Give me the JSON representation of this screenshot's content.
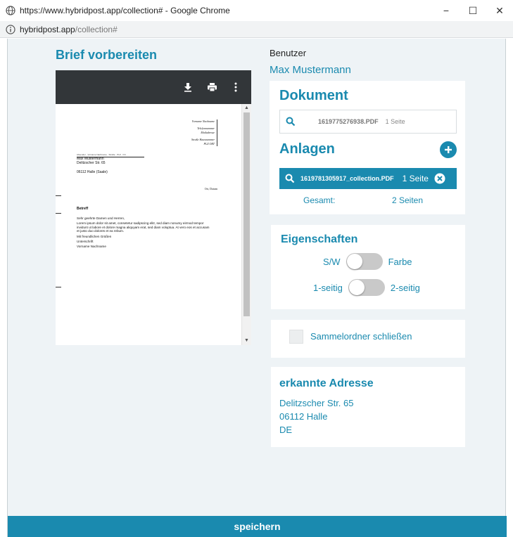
{
  "browser": {
    "title": "https://www.hybridpost.app/collection# - Google Chrome",
    "url_host": "hybridpost.app",
    "url_path": "/collection#",
    "minimize": "−",
    "maximize": "☐",
    "close": "✕"
  },
  "page": {
    "title": "Brief vorbereiten"
  },
  "user": {
    "label": "Benutzer",
    "name": "Max Mustermann"
  },
  "pdf_preview": {
    "icons": [
      "download-icon",
      "print-icon",
      "more-vert-icon"
    ],
    "scroll_up": "▲",
    "scroll_down": "▼",
    "letter": {
      "sender_lines": [
        "Vorname Nachname",
        "Telefonnummer",
        "Mailadresse",
        "Straße Hausnummer",
        "PLZ ORT"
      ],
      "return_address": "Absender · Vorname Nachname · Straße · PLZ · Ort",
      "recipient_lines": [
        "Max Mustermann",
        "Delitzscher Str. 65",
        "06112 Halle (Saale)"
      ],
      "place_date": "Ort, Datum",
      "subject": "Betreff",
      "salutation": "Sehr geehrte Damen und Herren,",
      "body": "Lorem ipsum dolor sit amet, consetetur sadipscing elitr, sed diam nonumy eirmod tempor invidunt ut labore et dolore magna aliquyam erat, sed diam voluptua. At vero eos et accusam et justo duo dolores et ea rebum.",
      "closing": "Mit freundlichen Grüßen",
      "signature": "Unterschrift",
      "name": "Vorname Nachname"
    }
  },
  "document": {
    "heading": "Dokument",
    "file": "1619775276938.PDF",
    "pages": "1 Seite"
  },
  "attachments": {
    "heading": "Anlagen",
    "items": [
      {
        "file": "1619781305917_collection.PDF",
        "pages": "1 Seite"
      }
    ],
    "total_label": "Gesamt:",
    "total_value": "2 Seiten"
  },
  "properties": {
    "heading": "Eigenschaften",
    "color_left": "S/W",
    "color_right": "Farbe",
    "sides_left": "1-seitig",
    "sides_right": "2-seitig",
    "color_on": false,
    "sides_on": false
  },
  "collection": {
    "label": "Sammelordner schließen",
    "checked": false
  },
  "address": {
    "heading": "erkannte Adresse",
    "line1": "Delitzscher Str. 65",
    "line2": "06112 Halle",
    "line3": "DE"
  },
  "actions": {
    "save": "speichern"
  },
  "colors": {
    "accent": "#1a8aaf",
    "background": "#eef3f6"
  }
}
